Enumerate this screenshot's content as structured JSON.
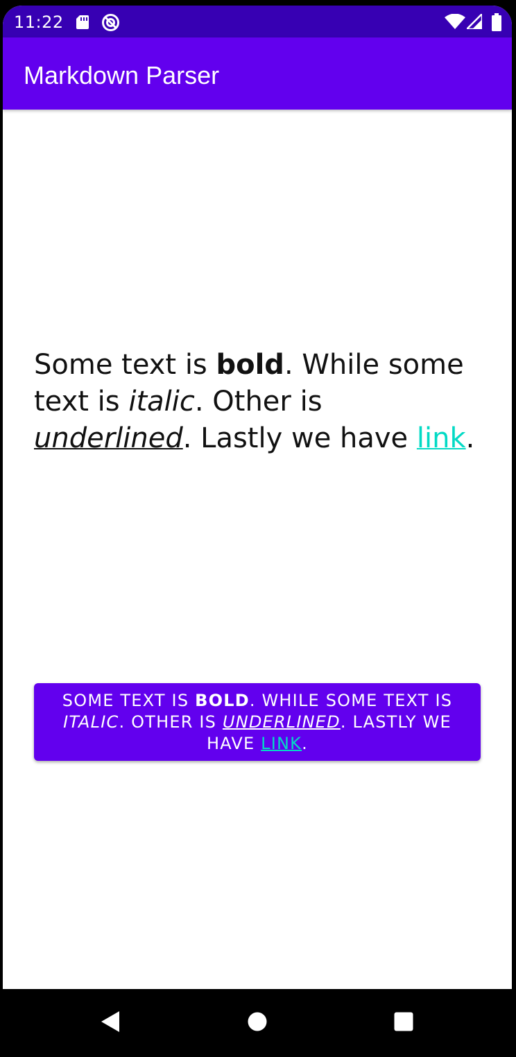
{
  "status_bar": {
    "time": "11:22",
    "icons": [
      "sd-card-icon",
      "sync-icon",
      "wifi-icon",
      "signal-icon",
      "battery-icon"
    ]
  },
  "app_bar": {
    "title": "Markdown Parser",
    "color": "#6200EE"
  },
  "content": {
    "parts": {
      "p1": "Some text is ",
      "bold": "bold",
      "p2": ". While some text is ",
      "italic": "italic",
      "p3": ". Other is ",
      "underlined": "underlined",
      "p4": ". Lastly we have ",
      "link": "link",
      "p5": "."
    }
  },
  "button": {
    "parts": {
      "p1": "Some text is ",
      "bold": "bold",
      "p2": ". While some text is ",
      "italic": "italic",
      "p3": ". Other is ",
      "underlined": "underlined",
      "p4": ". Lastly we have ",
      "link": "link",
      "p5": "."
    },
    "color": "#6200EE",
    "link_color": "#03DAC5"
  },
  "nav_bar": {
    "icons": [
      "back-icon",
      "home-icon",
      "recents-icon"
    ]
  }
}
